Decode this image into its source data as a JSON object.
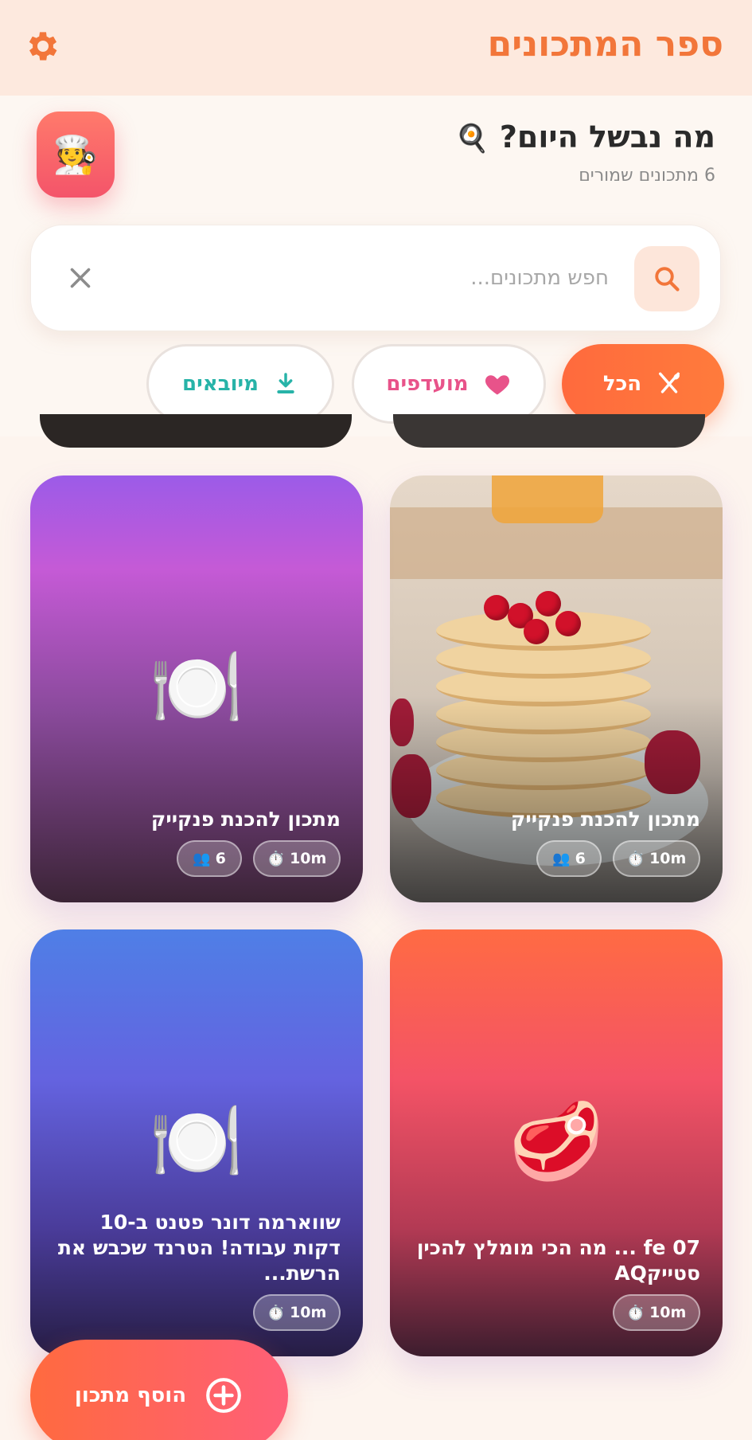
{
  "appbar": {
    "title": "ספר המתכונים",
    "settings_icon": "gear-icon"
  },
  "header": {
    "greeting": "מה נבשל היום?",
    "greeting_emoji": "🍳",
    "saved_count": "6 מתכונים שמורים",
    "avatar_emoji": "🧑‍🍳"
  },
  "search": {
    "placeholder": "חפש מתכונים...",
    "value": ""
  },
  "filters": [
    {
      "label": "הכל",
      "icon": "utensils-icon",
      "active": true
    },
    {
      "label": "מועדפים",
      "icon": "heart-icon",
      "active": false
    },
    {
      "label": "מיובאים",
      "icon": "download-icon",
      "active": false
    }
  ],
  "recipes": [
    {
      "title": "מתכון להכנת פנקייק",
      "time": "10m",
      "servings": "6",
      "image": "pancakes-photo"
    },
    {
      "title": "מתכון להכנת פנקייק",
      "time": "10m",
      "servings": "6",
      "emoji": "🍽️"
    },
    {
      "title": "07 fe ... מה הכי מומלץ להכין סטייקAQ",
      "time": "10m",
      "emoji": "🥩"
    },
    {
      "title": "שווארמה דונר פטנט ב-10 דקות עבודה! הטרנד שכבש את הרשת...",
      "time": "10m",
      "emoji": "🍽️"
    }
  ],
  "icons": {
    "time": "⏱️",
    "servings": "👥"
  },
  "fab": {
    "label": "הוסף מתכון",
    "icon": "plus-circle-icon"
  },
  "colors": {
    "accent": "#f2763a",
    "favorite": "#e8538a",
    "imported": "#27b3a8"
  }
}
